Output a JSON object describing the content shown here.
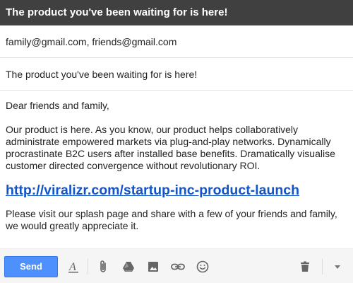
{
  "compose": {
    "title": "The product you've been waiting for is here!",
    "to": "family@gmail.com, friends@gmail.com",
    "subject": "The product you've been waiting for is here!",
    "body": {
      "greeting": "Dear friends and family,",
      "paragraph1": "Our product is here. As you know, our product helps collaboratively administrate empowered markets via plug-and-play networks. Dynamically procrastinate B2C users after installed base benefits. Dramatically visualise customer directed convergence without revolutionary ROI.",
      "link": "http://viralizr.com/startup-inc-product-launch",
      "paragraph2": "Please visit our splash page and share with a few of your friends and family, we would greatly appreciate it."
    }
  },
  "toolbar": {
    "send_label": "Send",
    "icons": [
      "format-text-icon",
      "attach-icon",
      "drive-icon",
      "photo-icon",
      "link-icon",
      "emoji-icon",
      "trash-icon",
      "more-options-icon"
    ]
  },
  "colors": {
    "titlebar": "#404040",
    "send_button": "#4d90fe",
    "link": "#1155cc"
  }
}
